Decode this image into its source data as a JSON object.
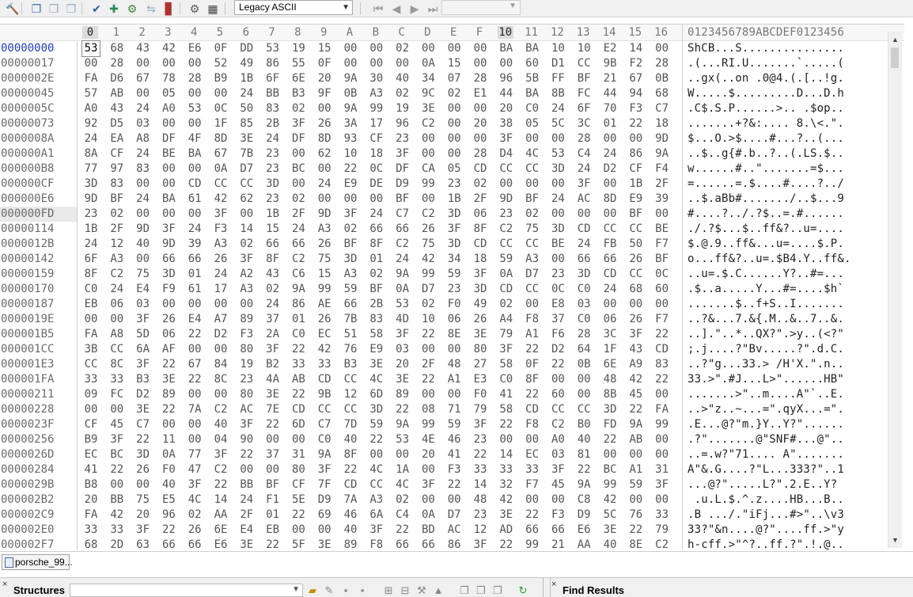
{
  "toolbar": {
    "buttons": [
      {
        "name": "hammer-icon",
        "glyph": "🔨"
      },
      {
        "name": "copy-icon",
        "glyph": "❐"
      },
      {
        "name": "copy2-icon",
        "glyph": "❐"
      },
      {
        "name": "paste-icon",
        "glyph": "❐"
      },
      {
        "name": "checksum-icon",
        "glyph": "✔"
      },
      {
        "name": "insert-icon",
        "glyph": "✚"
      },
      {
        "name": "structure-icon",
        "glyph": "⚙"
      },
      {
        "name": "compare-icon",
        "glyph": "⇋"
      },
      {
        "name": "chart-icon",
        "glyph": "▊"
      },
      {
        "name": "gear-icon",
        "glyph": "⚙"
      },
      {
        "name": "calculator-icon",
        "glyph": "▦"
      }
    ],
    "encoding": "Legacy ASCII",
    "nav": [
      "⏮",
      "◀",
      "▶",
      "⏭"
    ]
  },
  "editor": {
    "column_headers": [
      "0",
      "1",
      "2",
      "3",
      "4",
      "5",
      "6",
      "7",
      "8",
      "9",
      "A",
      "B",
      "C",
      "D",
      "E",
      "F",
      "10",
      "11",
      "12",
      "13",
      "14",
      "15",
      "16"
    ],
    "highlight_columns": [
      0,
      16
    ],
    "ascii_header": "0123456789ABCDEF0123456",
    "rows": [
      {
        "offset": "00000000",
        "hex": "53 68 43 42 E6 0F DD 53 19 15 00 00 02 00 00 00 BA BA 10 10 E2 14 00",
        "ascii": "ShCB...S..............."
      },
      {
        "offset": "00000017",
        "hex": "00 28 00 00 00 52 49 86 55 0F 00 00 00 0A 15 00 00 60 D1 CC 9B F2 28",
        "ascii": ".(...RI.U.......`.....("
      },
      {
        "offset": "0000002E",
        "hex": "FA D6 67 78 28 B9 1B 6F 6E 20 9A 30 40 34 07 28 96 5B FF BF 21 67 0B",
        "ascii": "..gx(..on .0@4.(.[..!g."
      },
      {
        "offset": "00000045",
        "hex": "57 AB 00 05 00 00 24 BB B3 9F 0B A3 02 9C 02 E1 44 BA 8B FC 44 94 68",
        "ascii": "W.....$.........D...D.h"
      },
      {
        "offset": "0000005C",
        "hex": "A0 43 24 A0 53 0C 50 83 02 00 9A 99 19 3E 00 00 20 C0 24 6F 70 F3 C7",
        "ascii": ".C$.S.P......>.. .$op.."
      },
      {
        "offset": "00000073",
        "hex": "92 D5 03 00 00 1F 85 2B 3F 26 3A 17 96 C2 00 20 38 05 5C 3C 01 22 18",
        "ascii": ".......+?&:.... 8.\\<.\"."
      },
      {
        "offset": "0000008A",
        "hex": "24 EA A8 DF 4F 8D 3E 24 DF 8D 93 CF 23 00 00 00 3F 00 00 28 00 00 9D",
        "ascii": "$...O.>$....#...?..(..."
      },
      {
        "offset": "000000A1",
        "hex": "8A CF 24 BE BA 67 7B 23 00 62 10 18 3F 00 00 28 D4 4C 53 C4 24 86 9A",
        "ascii": "..$..g{#.b..?..(.LS.$.."
      },
      {
        "offset": "000000B8",
        "hex": "77 97 83 00 00 0A D7 23 BC 00 22 0C DF CA 05 CD CC CC 3D 24 D2 CF F4",
        "ascii": "w......#..\".......=$..."
      },
      {
        "offset": "000000CF",
        "hex": "3D 83 00 00 CD CC CC 3D 00 24 E9 DE D9 99 23 02 00 00 00 3F 00 1B 2F",
        "ascii": "=......=.$....#....?../"
      },
      {
        "offset": "000000E6",
        "hex": "9D BF 24 BA 61 42 62 23 02 00 00 00 BF 00 1B 2F 9D BF 24 AC 8D E9 39",
        "ascii": "..$.aBb#......./..$...9"
      },
      {
        "offset": "000000FD",
        "hex": "23 02 00 00 00 3F 00 1B 2F 9D 3F 24 C7 C2 3D 06 23 02 00 00 00 BF 00",
        "ascii": "#....?../.?$..=.#......"
      },
      {
        "offset": "00000114",
        "hex": "1B 2F 9D 3F 24 F3 14 15 24 A3 02 66 66 26 3F 8F C2 75 3D CD CC CC BE",
        "ascii": "./.?$...$..ff&?..u=...."
      },
      {
        "offset": "0000012B",
        "hex": "24 12 40 9D 39 A3 02 66 66 26 BF 8F C2 75 3D CD CC CC BE 24 FB 50 F7",
        "ascii": "$.@.9..ff&...u=....$.P."
      },
      {
        "offset": "00000142",
        "hex": "6F A3 00 66 66 26 3F 8F C2 75 3D 01 24 42 34 18 59 A3 00 66 66 26 BF",
        "ascii": "o...ff&?..u=.$B4.Y..ff&."
      },
      {
        "offset": "00000159",
        "hex": "8F C2 75 3D 01 24 A2 43 C6 15 A3 02 9A 99 59 3F 0A D7 23 3D CD CC 0C",
        "ascii": "..u=.$.C......Y?..#=..."
      },
      {
        "offset": "00000170",
        "hex": "C0 24 E4 F9 61 17 A3 02 9A 99 59 BF 0A D7 23 3D CD CC 0C C0 24 68 60",
        "ascii": ".$..a.....Y...#=....$h`"
      },
      {
        "offset": "00000187",
        "hex": "EB 06 03 00 00 00 00 24 86 AE 66 2B 53 02 F0 49 02 00 E8 03 00 00 00",
        "ascii": ".......$..f+S..I......."
      },
      {
        "offset": "0000019E",
        "hex": "00 00 3F 26 E4 A7 89 37 01 26 7B 83 4D 10 06 26 A4 F8 37 C0 06 26 F7",
        "ascii": "..?&...7.&{.M..&..7..&."
      },
      {
        "offset": "000001B5",
        "hex": "FA A8 5D 06 22 D2 F3 2A C0 EC 51 58 3F 22 8E 3E 79 A1 F6 28 3C 3F 22",
        "ascii": "..].\"..*..QX?\".>y..(<?\""
      },
      {
        "offset": "000001CC",
        "hex": "3B CC 6A AF 00 00 80 3F 22 42 76 E9 03 00 00 80 3F 22 D2 64 1F 43 CD",
        "ascii": ";.j....?\"Bv.....?\".d.C."
      },
      {
        "offset": "000001E3",
        "hex": "CC 8C 3F 22 67 84 19 B2 33 33 B3 3E 20 2F 48 27 58 0F 22 0B 6E A9 83",
        "ascii": "..?\"g...33.> /H'X.\".n.."
      },
      {
        "offset": "000001FA",
        "hex": "33 33 B3 3E 22 8C 23 4A AB CD CC 4C 3E 22 A1 E3 C0 8F 00 00 48 42 22",
        "ascii": "33.>\".#J...L>\"......HB\""
      },
      {
        "offset": "00000211",
        "hex": "09 FC D2 89 00 00 80 3E 22 9B 12 6D 89 00 00 F0 41 22 60 00 8B 45 00",
        "ascii": ".......>\"..m....A\"`..E."
      },
      {
        "offset": "00000228",
        "hex": "00 00 3E 22 7A C2 AC 7E CD CC CC 3D 22 08 71 79 58 CD CC CC 3D 22 FA",
        "ascii": "..>\"z..~...=\".qyX...=\"."
      },
      {
        "offset": "0000023F",
        "hex": "CF 45 C7 00 00 40 3F 22 6D C7 7D 59 9A 99 59 3F 22 F8 C2 B0 FD 9A 99",
        "ascii": ".E...@?\"m.}Y..Y?\"......"
      },
      {
        "offset": "00000256",
        "hex": "B9 3F 22 11 00 04 90 00 00 C0 40 22 53 4E 46 23 00 00 A0 40 22 AB 00",
        "ascii": ".?\".......@\"SNF#...@\".."
      },
      {
        "offset": "0000026D",
        "hex": "EC BC 3D 0A 77 3F 22 37 31 9A 8F 00 00 20 41 22 14 EC 03 81 00 00 00",
        "ascii": "..=.w?\"71.... A\"......."
      },
      {
        "offset": "00000284",
        "hex": "41 22 26 F0 47 C2 00 00 80 3F 22 4C 1A 00 F3 33 33 33 3F 22 BC A1 31",
        "ascii": "A\"&.G....?\"L...333?\"..1"
      },
      {
        "offset": "0000029B",
        "hex": "B8 00 00 40 3F 22 BB BF CF 7F CD CC 4C 3F 22 14 32 F7 45 9A 99 59 3F",
        "ascii": "...@?\".....L?\".2.E..Y?"
      },
      {
        "offset": "000002B2",
        "hex": "20 BB 75 E5 4C 14 24 F1 5E D9 7A A3 02 00 00 48 42 00 00 C8 42 00 00",
        "ascii": " .u.L.$.^.z....HB...B.."
      },
      {
        "offset": "000002C9",
        "hex": "FA 42 20 96 02 AA 2F 01 22 69 46 6A C4 0A D7 23 3E 22 F3 D9 5C 76 33",
        "ascii": ".B .../.\"iFj...#>\"..\\v3"
      },
      {
        "offset": "000002E0",
        "hex": "33 33 3F 22 26 6E E4 EB 00 00 40 3F 22 BD AC 12 AD 66 66 E6 3E 22 79",
        "ascii": "33?\"&n....@?\"....ff.>\"y"
      },
      {
        "offset": "000002F7",
        "hex": "68 2D 63 66 66 E6 3E 22 5F 3E 89 F8 66 66 86 3F 22 99 21 AA 40 8E C2",
        "ascii": "h-cff.>\"^?..ff.?\".!.@.."
      }
    ]
  },
  "file_tab": {
    "label": "porsche_99..."
  },
  "bottom": {
    "structures_title": "Structures",
    "find_title": "Find Results",
    "close_glyph": "×"
  },
  "colors": {
    "accent": "#1f3cc8",
    "panel": "#f0f0f0",
    "grid_text": "#555555"
  }
}
